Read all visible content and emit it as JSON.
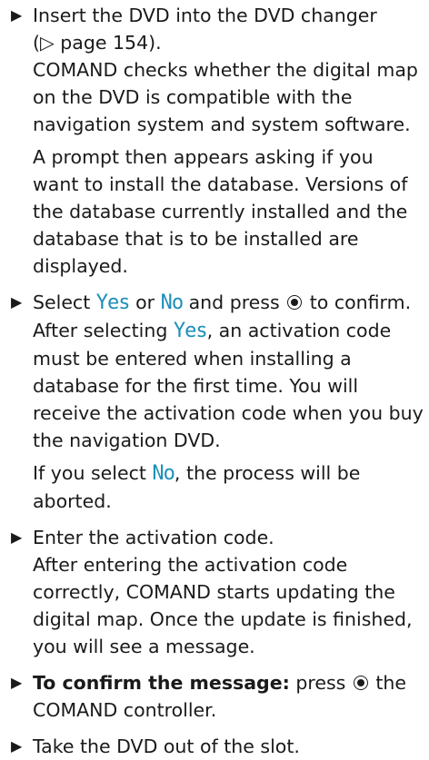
{
  "bullet_symbol": "▶",
  "step1": {
    "line1": "Insert the DVD into the DVD changer",
    "line2": "(▷ page 154).",
    "body": "COMAND checks whether the digital map on the DVD is compatible with the navigation system and system software.",
    "note": "A prompt then appears asking if you want to install the database. Versions of the database currently installed and the database that is to be installed are displayed."
  },
  "step2": {
    "select": "Select",
    "yes": "Yes",
    "or": "or",
    "no": "No",
    "press_confirm": "and press",
    "to_confirm": "to confirm.",
    "after_selecting": "After selecting",
    "activation_text": ", an activation code must be entered when installing a database for the first time. You will receive the activation code when you buy the navigation DVD.",
    "if_select": "If you select",
    "aborted": ", the process will be aborted."
  },
  "step3": {
    "line1": "Enter the activation code.",
    "body": "After entering the activation code correctly, COMAND starts updating the digital map. Once the update is finished, you will see a message."
  },
  "step4": {
    "bold": "To confirm the message:",
    "press": "press",
    "rest": "the COMAND controller."
  },
  "step5": {
    "line1": "Take the DVD out of the slot."
  },
  "icons": {
    "bullet": "triangle-bullet-icon",
    "controller": "controller-knob-icon"
  },
  "colors": {
    "term": "#1d8fb8",
    "text": "#1a1a1a"
  }
}
